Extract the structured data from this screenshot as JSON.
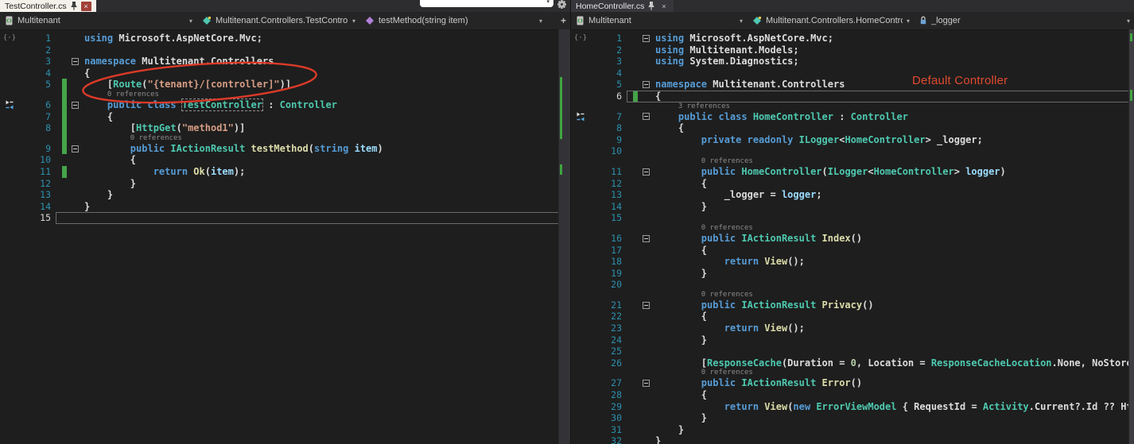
{
  "glyphs": {
    "close": "×",
    "caret": "▾",
    "split": "+",
    "braces_margin": "{·}"
  },
  "colors": {
    "keyword": "#569CD6",
    "type": "#4EC9B0",
    "method": "#DCDCAA",
    "string": "#D69D85",
    "text": "#DCDCDC",
    "parameter": "#9CDCFE",
    "number": "#B5CEA8",
    "line_number": "#2B91AF",
    "codelens": "#8C8C8C",
    "change_bar": "#45A349",
    "annotation": "#E04A2F",
    "active_tab_light": "#F3F1E9",
    "editor_bg": "#1E1E1E"
  },
  "left_pane": {
    "tab": {
      "title": "TestController.cs"
    },
    "breadcrumb": {
      "project": "Multitenant",
      "type": "Multitenant.Controllers.TestController",
      "member": "testMethod(string item)"
    },
    "lines": [
      {
        "n": 1,
        "glyph": "braces",
        "t": [
          [
            "k",
            "using "
          ],
          [
            "n",
            "Microsoft.AspNetCore.Mvc;"
          ]
        ]
      },
      {
        "n": 2,
        "t": []
      },
      {
        "n": 3,
        "fold": 1,
        "t": [
          [
            "k",
            "namespace "
          ],
          [
            "n",
            "Multitenant.Controllers"
          ]
        ]
      },
      {
        "n": 4,
        "t": [
          [
            "n",
            "{"
          ]
        ]
      },
      {
        "n": 5,
        "bar": 1,
        "t": [
          [
            "n",
            "    ["
          ],
          [
            "ty",
            "Route"
          ],
          [
            "n",
            "("
          ],
          [
            "s",
            "\"{tenant}/[controller]\""
          ],
          [
            "n",
            ")]"
          ]
        ]
      },
      {
        "n": 6,
        "bar": 1,
        "fold": 1,
        "glyph": "bookmark",
        "lens": "0 references",
        "lensIndent": 4,
        "lensBar": 1,
        "t": [
          [
            "n",
            "    "
          ],
          [
            "k",
            "public class "
          ],
          [
            "hl",
            "TestController"
          ],
          [
            "n",
            " : "
          ],
          [
            "ty",
            "Controller"
          ]
        ]
      },
      {
        "n": 7,
        "bar": 1,
        "t": [
          [
            "n",
            "    {"
          ]
        ]
      },
      {
        "n": 8,
        "bar": 1,
        "t": [
          [
            "n",
            "        ["
          ],
          [
            "ty",
            "HttpGet"
          ],
          [
            "n",
            "("
          ],
          [
            "s",
            "\"method1\""
          ],
          [
            "n",
            ")]"
          ]
        ]
      },
      {
        "n": 9,
        "bar": 1,
        "fold": 1,
        "lens": "0 references",
        "lensIndent": 8,
        "lensBar": 1,
        "t": [
          [
            "n",
            "        "
          ],
          [
            "k",
            "public "
          ],
          [
            "ty",
            "IActionResult"
          ],
          [
            "n",
            " "
          ],
          [
            "m",
            "testMethod"
          ],
          [
            "n",
            "("
          ],
          [
            "k",
            "string"
          ],
          [
            "n",
            " "
          ],
          [
            "pm",
            "item"
          ],
          [
            "n",
            ")"
          ]
        ]
      },
      {
        "n": 10,
        "t": [
          [
            "n",
            "        {"
          ]
        ]
      },
      {
        "n": 11,
        "bar": 1,
        "t": [
          [
            "n",
            "            "
          ],
          [
            "k",
            "return "
          ],
          [
            "m",
            "Ok"
          ],
          [
            "n",
            "("
          ],
          [
            "pm",
            "item"
          ],
          [
            "n",
            ");"
          ]
        ]
      },
      {
        "n": 12,
        "t": [
          [
            "n",
            "        }"
          ]
        ]
      },
      {
        "n": 13,
        "t": [
          [
            "n",
            "    }"
          ]
        ]
      },
      {
        "n": 14,
        "t": [
          [
            "n",
            "}"
          ]
        ]
      },
      {
        "n": 15,
        "cur": 1,
        "t": []
      }
    ]
  },
  "right_pane": {
    "tab": {
      "title": "HomeController.cs"
    },
    "breadcrumb": {
      "project": "Multitenant",
      "type": "Multitenant.Controllers.HomeController",
      "member": "_logger"
    },
    "annotation": "Default Controller",
    "lines": [
      {
        "n": 1,
        "glyph": "braces",
        "fold": 1,
        "t": [
          [
            "k",
            "using "
          ],
          [
            "n",
            "Microsoft.AspNetCore.Mvc;"
          ]
        ]
      },
      {
        "n": 2,
        "t": [
          [
            "k",
            "using "
          ],
          [
            "n",
            "Multitenant.Models;"
          ]
        ]
      },
      {
        "n": 3,
        "t": [
          [
            "k",
            "using "
          ],
          [
            "n",
            "System.Diagnostics;"
          ]
        ]
      },
      {
        "n": 4,
        "t": []
      },
      {
        "n": 5,
        "fold": 1,
        "t": [
          [
            "k",
            "namespace "
          ],
          [
            "n",
            "Multitenant.Controllers"
          ]
        ]
      },
      {
        "n": 6,
        "cur": 1,
        "bar": 1,
        "t": [
          [
            "n",
            "{"
          ]
        ]
      },
      {
        "n": 7,
        "fold": 1,
        "glyph": "bookmark",
        "lens": "3 references",
        "lensIndent": 4,
        "t": [
          [
            "n",
            "    "
          ],
          [
            "k",
            "public class "
          ],
          [
            "ty",
            "HomeController"
          ],
          [
            "n",
            " : "
          ],
          [
            "ty",
            "Controller"
          ]
        ]
      },
      {
        "n": 8,
        "t": [
          [
            "n",
            "    {"
          ]
        ]
      },
      {
        "n": 9,
        "t": [
          [
            "n",
            "        "
          ],
          [
            "k",
            "private readonly "
          ],
          [
            "ty",
            "ILogger"
          ],
          [
            "n",
            "<"
          ],
          [
            "ty",
            "HomeController"
          ],
          [
            "n",
            "> _logger;"
          ]
        ]
      },
      {
        "n": 10,
        "t": []
      },
      {
        "n": 11,
        "fold": 1,
        "lens": "0 references",
        "lensIndent": 8,
        "t": [
          [
            "n",
            "        "
          ],
          [
            "k",
            "public "
          ],
          [
            "ty",
            "HomeController"
          ],
          [
            "n",
            "("
          ],
          [
            "ty",
            "ILogger"
          ],
          [
            "n",
            "<"
          ],
          [
            "ty",
            "HomeController"
          ],
          [
            "n",
            "> "
          ],
          [
            "pm",
            "logger"
          ],
          [
            "n",
            ")"
          ]
        ]
      },
      {
        "n": 12,
        "t": [
          [
            "n",
            "        {"
          ]
        ]
      },
      {
        "n": 13,
        "t": [
          [
            "n",
            "            _logger = "
          ],
          [
            "pm",
            "logger"
          ],
          [
            "n",
            ";"
          ]
        ]
      },
      {
        "n": 14,
        "t": [
          [
            "n",
            "        }"
          ]
        ]
      },
      {
        "n": 15,
        "t": []
      },
      {
        "n": 16,
        "fold": 1,
        "lens": "0 references",
        "lensIndent": 8,
        "t": [
          [
            "n",
            "        "
          ],
          [
            "k",
            "public "
          ],
          [
            "ty",
            "IActionResult"
          ],
          [
            "n",
            " "
          ],
          [
            "m",
            "Index"
          ],
          [
            "n",
            "()"
          ]
        ]
      },
      {
        "n": 17,
        "t": [
          [
            "n",
            "        {"
          ]
        ]
      },
      {
        "n": 18,
        "t": [
          [
            "n",
            "            "
          ],
          [
            "k",
            "return "
          ],
          [
            "m",
            "View"
          ],
          [
            "n",
            "();"
          ]
        ]
      },
      {
        "n": 19,
        "t": [
          [
            "n",
            "        }"
          ]
        ]
      },
      {
        "n": 20,
        "t": []
      },
      {
        "n": 21,
        "fold": 1,
        "lens": "0 references",
        "lensIndent": 8,
        "t": [
          [
            "n",
            "        "
          ],
          [
            "k",
            "public "
          ],
          [
            "ty",
            "IActionResult"
          ],
          [
            "n",
            " "
          ],
          [
            "m",
            "Privacy"
          ],
          [
            "n",
            "()"
          ]
        ]
      },
      {
        "n": 22,
        "t": [
          [
            "n",
            "        {"
          ]
        ]
      },
      {
        "n": 23,
        "t": [
          [
            "n",
            "            "
          ],
          [
            "k",
            "return "
          ],
          [
            "m",
            "View"
          ],
          [
            "n",
            "();"
          ]
        ]
      },
      {
        "n": 24,
        "t": [
          [
            "n",
            "        }"
          ]
        ]
      },
      {
        "n": 25,
        "t": []
      },
      {
        "n": 26,
        "t": [
          [
            "n",
            "        ["
          ],
          [
            "ty",
            "ResponseCache"
          ],
          [
            "n",
            "(Duration = "
          ],
          [
            "num",
            "0"
          ],
          [
            "n",
            ", Location = "
          ],
          [
            "ty",
            "ResponseCacheLocation"
          ],
          [
            "n",
            ".None, NoStore = "
          ],
          [
            "k",
            "true"
          ],
          [
            "n",
            ")]"
          ]
        ]
      },
      {
        "n": 27,
        "fold": 1,
        "lens": "0 references",
        "lensIndent": 8,
        "t": [
          [
            "n",
            "        "
          ],
          [
            "k",
            "public "
          ],
          [
            "ty",
            "IActionResult"
          ],
          [
            "n",
            " "
          ],
          [
            "m",
            "Error"
          ],
          [
            "n",
            "()"
          ]
        ]
      },
      {
        "n": 28,
        "t": [
          [
            "n",
            "        {"
          ]
        ]
      },
      {
        "n": 29,
        "t": [
          [
            "n",
            "            "
          ],
          [
            "k",
            "return "
          ],
          [
            "m",
            "View"
          ],
          [
            "n",
            "("
          ],
          [
            "k",
            "new "
          ],
          [
            "ty",
            "ErrorViewModel"
          ],
          [
            "n",
            " { RequestId = "
          ],
          [
            "ty",
            "Activity"
          ],
          [
            "n",
            ".Current?.Id ?? HttpContext.TraceIdentifier });"
          ]
        ]
      },
      {
        "n": 30,
        "t": [
          [
            "n",
            "        }"
          ]
        ]
      },
      {
        "n": 31,
        "t": [
          [
            "n",
            "    }"
          ]
        ]
      },
      {
        "n": 32,
        "t": [
          [
            "n",
            "}"
          ]
        ]
      }
    ]
  }
}
